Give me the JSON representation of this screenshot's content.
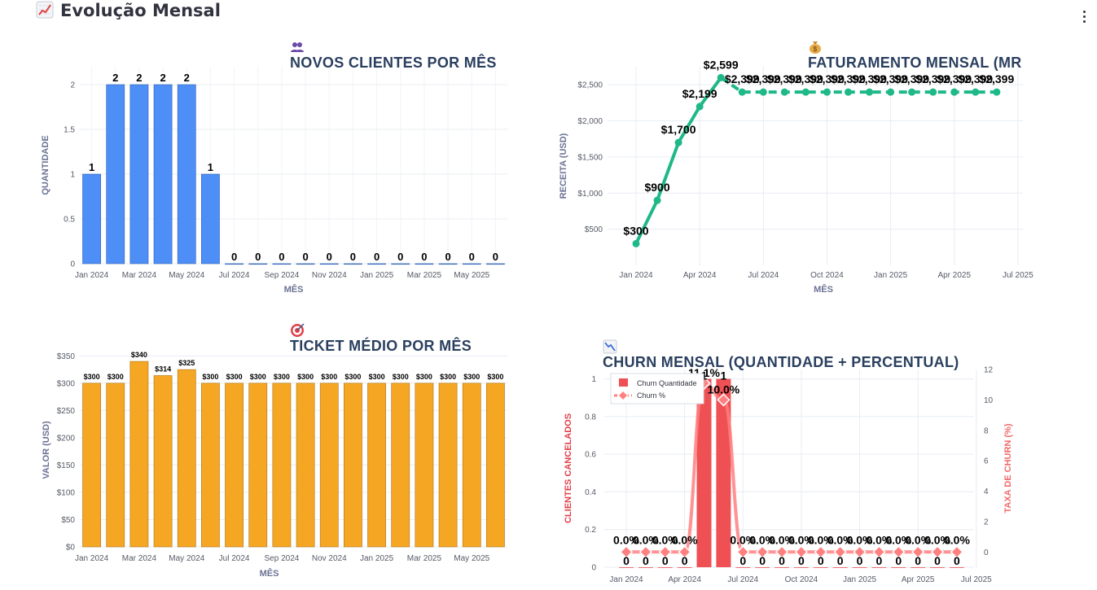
{
  "page": {
    "title": "Evolução Mensal",
    "title_icon": "chart-increasing-icon",
    "menu_icon": "kebab-menu-icon"
  },
  "charts": {
    "novos": {
      "title": "NOVOS CLIENTES POR MÊS",
      "icon": "people-icon"
    },
    "faturamento": {
      "title": "FATURAMENTO MENSAL (MR",
      "icon": "money-bag-icon"
    },
    "ticket": {
      "title": "TICKET MÉDIO POR MÊS",
      "icon": "target-icon"
    },
    "churn": {
      "title": "CHURN MENSAL (QUANTIDADE + PERCENTUAL)",
      "icon": "chart-decreasing-icon"
    }
  },
  "colors": {
    "blue_bar": "#4d8ef7",
    "green_line": "#1fb888",
    "orange_bar": "#f5a623",
    "red_bar": "#ef5054",
    "churn_line": "#ff8080",
    "axis_title": "#6b7394",
    "title": "#2a3f5f",
    "grid": "#e8ecf2"
  },
  "chart_data": [
    {
      "id": "novos",
      "type": "bar",
      "title": "NOVOS CLIENTES POR MÊS",
      "xlabel": "MÊS",
      "ylabel": "QUANTIDADE",
      "ylim": [
        0,
        2.2
      ],
      "yticks": [
        0,
        0.5,
        1,
        1.5,
        2
      ],
      "ytick_labels": [
        "0",
        "0.5",
        "1",
        "1.5",
        "2"
      ],
      "xtick_labels": [
        "Jan 2024",
        "Mar 2024",
        "May 2024",
        "Jul 2024",
        "Sep 2024",
        "Nov 2024",
        "Jan 2025",
        "Mar 2025",
        "May 2025"
      ],
      "grid": true,
      "categories": [
        "Jan 2024",
        "Feb 2024",
        "Mar 2024",
        "Apr 2024",
        "May 2024",
        "Jun 2024",
        "Jul 2024",
        "Aug 2024",
        "Sep 2024",
        "Oct 2024",
        "Nov 2024",
        "Dec 2024",
        "Jan 2025",
        "Feb 2025",
        "Mar 2025",
        "Apr 2025",
        "May 2025",
        "Jun 2025"
      ],
      "values": [
        1,
        2,
        2,
        2,
        2,
        1,
        0,
        0,
        0,
        0,
        0,
        0,
        0,
        0,
        0,
        0,
        0,
        0
      ],
      "data_labels": [
        "1",
        "2",
        "2",
        "2",
        "2",
        "1",
        "0",
        "0",
        "0",
        "0",
        "0",
        "0",
        "0",
        "0",
        "0",
        "0",
        "0",
        "0"
      ]
    },
    {
      "id": "faturamento",
      "type": "line",
      "title": "FATURAMENTO MENSAL (MR",
      "xlabel": "MÊS",
      "ylabel": "RECEITA (USD)",
      "ylim": [
        0,
        2750
      ],
      "yticks": [
        500,
        1000,
        1500,
        2000,
        2500
      ],
      "ytick_labels": [
        "$500",
        "$1,000",
        "$1,500",
        "$2,000",
        "$2,500"
      ],
      "xtick_labels": [
        "Jan 2024",
        "Apr 2024",
        "Jul 2024",
        "Oct 2024",
        "Jan 2025",
        "Apr 2025",
        "Jul 2025"
      ],
      "grid": true,
      "x": [
        "Jan 2024",
        "Feb 2024",
        "Mar 2024",
        "Apr 2024",
        "May 2024",
        "Jun 2024",
        "Jul 2024",
        "Aug 2024",
        "Sep 2024",
        "Oct 2024",
        "Nov 2024",
        "Dec 2024",
        "Jan 2025",
        "Feb 2025",
        "Mar 2025",
        "Apr 2025",
        "May 2025",
        "Jun 2025"
      ],
      "values": [
        300,
        900,
        1700,
        2199,
        2599,
        2399,
        2399,
        2399,
        2399,
        2399,
        2399,
        2399,
        2399,
        2399,
        2399,
        2399,
        2399,
        2399
      ],
      "data_labels": [
        "$300",
        "$900",
        "$1,700",
        "$2,199",
        "$2,599",
        "$2,399",
        "$2,399",
        "$2,399",
        "$2,399",
        "$2,399",
        "$2,399",
        "$2,399",
        "$2,399",
        "$2,399",
        "$2,399",
        "$2,399",
        "$2,399",
        "$2,399"
      ]
    },
    {
      "id": "ticket",
      "type": "bar",
      "title": "TICKET MÉDIO POR MÊS",
      "xlabel": "MÊS",
      "ylabel": "VALOR (USD)",
      "ylim": [
        0,
        355
      ],
      "yticks": [
        0,
        50,
        100,
        150,
        200,
        250,
        300,
        350
      ],
      "ytick_labels": [
        "$0",
        "$50",
        "$100",
        "$150",
        "$200",
        "$250",
        "$300",
        "$350"
      ],
      "xtick_labels": [
        "Jan 2024",
        "Mar 2024",
        "May 2024",
        "Jul 2024",
        "Sep 2024",
        "Nov 2024",
        "Jan 2025",
        "Mar 2025",
        "May 2025"
      ],
      "grid": true,
      "categories": [
        "Jan 2024",
        "Feb 2024",
        "Mar 2024",
        "Apr 2024",
        "May 2024",
        "Jun 2024",
        "Jul 2024",
        "Aug 2024",
        "Sep 2024",
        "Oct 2024",
        "Nov 2024",
        "Dec 2024",
        "Jan 2025",
        "Feb 2025",
        "Mar 2025",
        "Apr 2025",
        "May 2025",
        "Jun 2025"
      ],
      "values": [
        300,
        300,
        340,
        314,
        325,
        300,
        300,
        300,
        300,
        300,
        300,
        300,
        300,
        300,
        300,
        300,
        300,
        300
      ],
      "data_labels": [
        "$300",
        "$300",
        "$340",
        "$314",
        "$325",
        "$300",
        "$300",
        "$300",
        "$300",
        "$300",
        "$300",
        "$300",
        "$300",
        "$300",
        "$300",
        "$300",
        "$300",
        "$300"
      ]
    },
    {
      "id": "churn",
      "type": "bar",
      "title": "CHURN MENSAL (QUANTIDADE + PERCENTUAL)",
      "ylabel": "CLIENTES CANCELADOS",
      "y2label": "TAXA DE CHURN (%)",
      "ylim": [
        0,
        1.05
      ],
      "y2lim": [
        -1,
        12
      ],
      "yticks": [
        0,
        0.2,
        0.4,
        0.6,
        0.8,
        1
      ],
      "ytick_labels": [
        "0",
        "0.2",
        "0.4",
        "0.6",
        "0.8",
        "1"
      ],
      "y2ticks": [
        0,
        2,
        4,
        6,
        8,
        10,
        12
      ],
      "y2tick_labels": [
        "0",
        "2",
        "4",
        "6",
        "8",
        "10",
        "12"
      ],
      "xtick_labels": [
        "Jan 2024",
        "Apr 2024",
        "Jul 2024",
        "Oct 2024",
        "Jan 2025",
        "Apr 2025",
        "Jul 2025"
      ],
      "legend_position": "top-left",
      "grid": true,
      "x": [
        "Jan 2024",
        "Feb 2024",
        "Mar 2024",
        "Apr 2024",
        "May 2024",
        "Jun 2024",
        "Jul 2024",
        "Aug 2024",
        "Sep 2024",
        "Oct 2024",
        "Nov 2024",
        "Dec 2024",
        "Jan 2025",
        "Feb 2025",
        "Mar 2025",
        "Apr 2025",
        "May 2025",
        "Jun 2025"
      ],
      "series": [
        {
          "name": "Churn Quantidade",
          "kind": "bar",
          "values": [
            0,
            0,
            0,
            0,
            1,
            1,
            0,
            0,
            0,
            0,
            0,
            0,
            0,
            0,
            0,
            0,
            0,
            0
          ],
          "data_labels": [
            "0",
            "0",
            "0",
            "0",
            "1",
            "1",
            "0",
            "0",
            "0",
            "0",
            "0",
            "0",
            "0",
            "0",
            "0",
            "0",
            "0",
            "0"
          ]
        },
        {
          "name": "Churn %",
          "kind": "line",
          "values": [
            0,
            0,
            0,
            0,
            11.1,
            10.0,
            0,
            0,
            0,
            0,
            0,
            0,
            0,
            0,
            0,
            0,
            0,
            0
          ],
          "data_labels": [
            "0.0%",
            "0.0%",
            "0.0%",
            "0.0%",
            "11.1%",
            "10.0%",
            "0.0%",
            "0.0%",
            "0.0%",
            "0.0%",
            "0.0%",
            "0.0%",
            "0.0%",
            "0.0%",
            "0.0%",
            "0.0%",
            "0.0%",
            "0.0%"
          ]
        }
      ]
    }
  ]
}
